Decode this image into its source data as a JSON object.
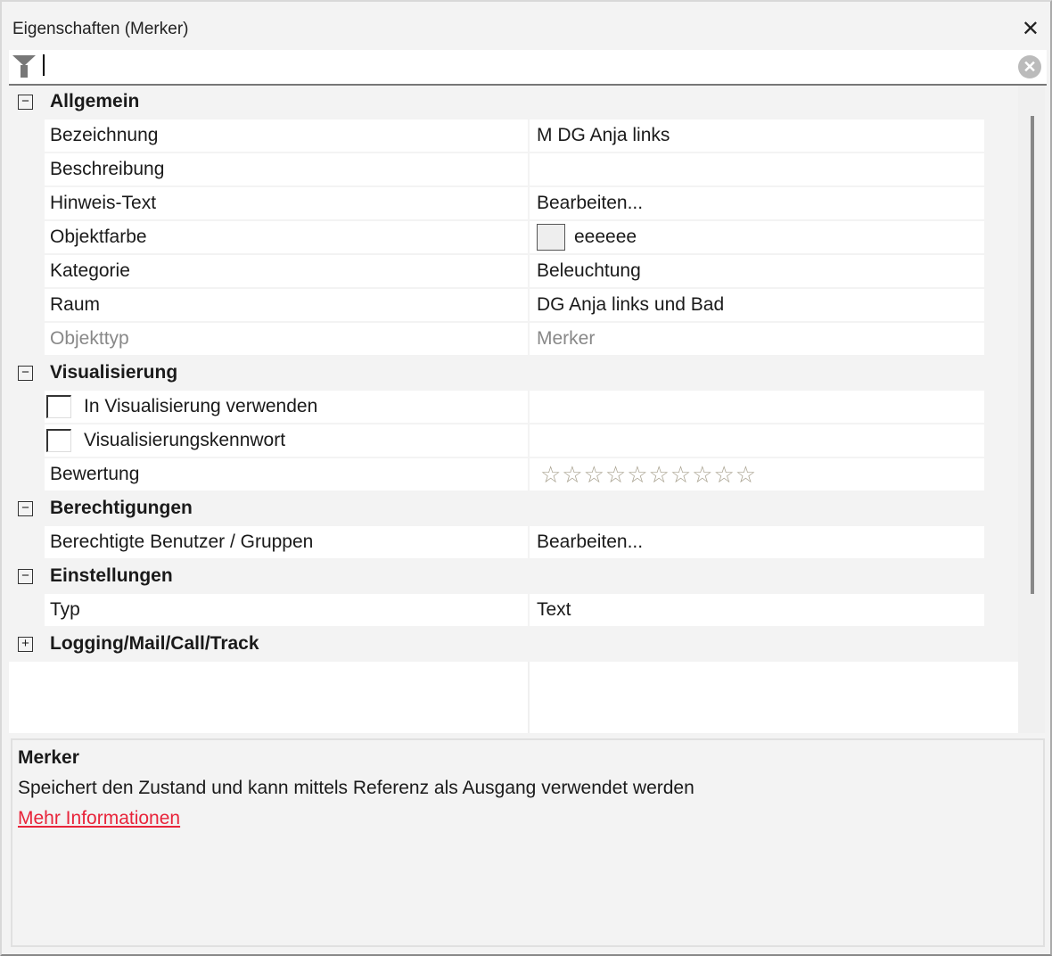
{
  "window": {
    "title": "Eigenschaften (Merker)",
    "close": "✕"
  },
  "filter": {
    "value": "",
    "clear": "✕"
  },
  "groups": [
    {
      "label": "Allgemein",
      "toggle": "−",
      "rows": [
        {
          "name": "Bezeichnung",
          "value": "M DG Anja links"
        },
        {
          "name": "Beschreibung",
          "value": ""
        },
        {
          "name": "Hinweis-Text",
          "value": "Bearbeiten..."
        },
        {
          "name": "Objektfarbe",
          "value": "eeeeee",
          "color": "#eeeeee"
        },
        {
          "name": "Kategorie",
          "value": "Beleuchtung"
        },
        {
          "name": "Raum",
          "value": "DG Anja links und Bad"
        },
        {
          "name": "Objekttyp",
          "value": "Merker",
          "disabled": true
        }
      ]
    },
    {
      "label": "Visualisierung",
      "toggle": "−",
      "rows": [
        {
          "name": "In Visualisierung verwenden",
          "checked": false
        },
        {
          "name": "Visualisierungskennwort",
          "checked": false
        },
        {
          "name": "Bewertung",
          "stars": "☆☆☆☆☆☆☆☆☆☆",
          "rating": 0,
          "max": 10
        }
      ]
    },
    {
      "label": "Berechtigungen",
      "toggle": "−",
      "rows": [
        {
          "name": "Berechtigte Benutzer / Gruppen",
          "value": "Bearbeiten..."
        }
      ]
    },
    {
      "label": "Einstellungen",
      "toggle": "−",
      "rows": [
        {
          "name": "Typ",
          "value": "Text"
        }
      ]
    },
    {
      "label": "Logging/Mail/Call/Track",
      "toggle": "+",
      "rows": []
    }
  ],
  "description": {
    "title": "Merker",
    "text": "Speichert den Zustand und kann mittels Referenz als Ausgang verwendet werden",
    "link": "Mehr Informationen",
    "link_color": "#e8243a"
  }
}
